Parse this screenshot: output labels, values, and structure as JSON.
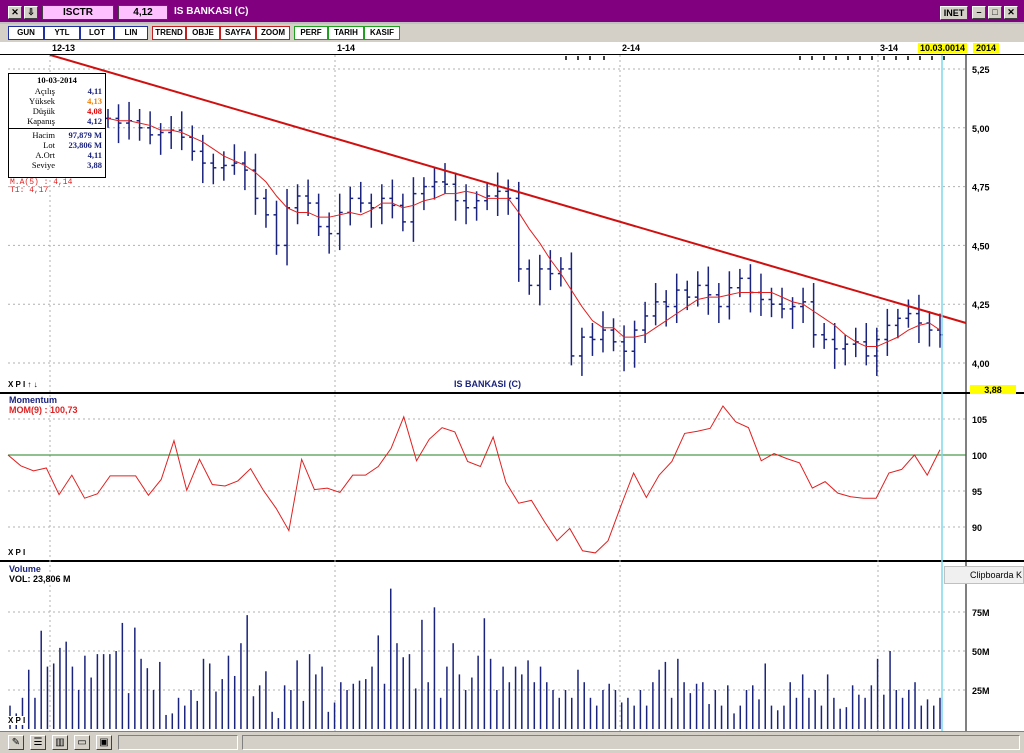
{
  "window": {
    "symbol": "ISCTR",
    "price": "4,12",
    "title": "IS BANKASI (C)",
    "inet_label": "INET"
  },
  "toolbar": {
    "gun": "GUN",
    "ytl": "YTL",
    "lot": "LOT",
    "lin": "LIN",
    "trend": "TREND",
    "obje": "OBJE",
    "sayfa": "SAYFA",
    "zoom": "ZOOM",
    "perf": "PERF",
    "tarih": "TARIH",
    "kasif": "KASIF",
    "e": "E"
  },
  "datebar": {
    "d1": "12-13",
    "d2": "1-14",
    "d3": "2-14",
    "d4": "3-14",
    "current_date": "10.03.0014",
    "year": "2014"
  },
  "info_box": {
    "date": "10-03-2014",
    "acilis_label": "Açılış",
    "acilis": "4,11",
    "yuksek_label": "Yüksek",
    "yuksek": "4,13",
    "dusuk_label": "Düşük",
    "dusuk": "4,08",
    "kapanis_label": "Kapanış",
    "kapanis": "4,12",
    "hacim_label": "Hacim",
    "hacim": "97,879 M",
    "lot_label": "Lot",
    "lot": "23,806 M",
    "aort_label": "A.Ort",
    "aort": "4,11",
    "seviye_label": "Seviye",
    "seviye": "3,88"
  },
  "overlays": {
    "ma": "M.A(5) : 4,14",
    "t1": "T1: 4,17"
  },
  "price_panel": {
    "title": "IS BANKASI (C)",
    "y_ticks": [
      "5,25",
      "5,00",
      "4,75",
      "4,50",
      "4,25",
      "4,00"
    ],
    "level_badge": "3,88",
    "controls": "X P I ↑ ↓"
  },
  "momentum_panel": {
    "title": "Momentum",
    "value_label": "MOM(9) : 100,73",
    "y_ticks": [
      "105",
      "100",
      "95",
      "90"
    ],
    "controls": "X P I"
  },
  "volume_panel": {
    "title": "Volume",
    "value_label": "VOL: 23,806 M",
    "y_ticks": [
      "75M",
      "50M",
      "25M"
    ],
    "controls": "X P I"
  },
  "tooltip": "Clipboarda K",
  "colors": {
    "window": "#800080",
    "bars": "#1a237e",
    "ma": "#e02020",
    "trend": "#d01010",
    "highlight": "#ffff00",
    "cursor": "#7fd8ec"
  },
  "chart_data": [
    {
      "type": "ohlc",
      "title": "IS BANKASI (C)",
      "x": [
        "12-13",
        "1-14",
        "2-14",
        "3-14"
      ],
      "ylim": [
        3.88,
        5.3
      ],
      "last": {
        "date": "10-03-2014",
        "open": 4.11,
        "high": 4.13,
        "low": 4.08,
        "close": 4.12
      },
      "close_series": [
        5.04,
        5.02,
        5.03,
        5.0,
        4.97,
        4.98,
        4.99,
        4.96,
        4.9,
        4.85,
        4.83,
        4.84,
        4.85,
        4.82,
        4.7,
        4.63,
        4.5,
        4.66,
        4.71,
        4.68,
        4.58,
        4.55,
        4.64,
        4.7,
        4.68,
        4.66,
        4.7,
        4.67,
        4.6,
        4.72,
        4.75,
        4.77,
        4.76,
        4.69,
        4.66,
        4.69,
        4.71,
        4.73,
        4.7,
        4.4,
        4.33,
        4.4,
        4.38,
        4.4,
        4.03,
        4.11,
        4.1,
        4.14,
        4.09,
        4.05,
        4.14,
        4.2,
        4.26,
        4.24,
        4.31,
        4.28,
        4.33,
        4.29,
        4.24,
        4.32,
        4.36,
        4.3,
        4.27,
        4.25,
        4.23,
        4.24,
        4.26,
        4.12,
        4.1,
        4.06,
        4.08,
        4.09,
        4.03,
        4.1,
        4.16,
        4.19,
        4.21,
        4.17,
        4.14,
        4.12
      ],
      "series": [
        {
          "name": "M.A(5)",
          "values": [
            5.04,
            5.03,
            5.03,
            5.02,
            5.01,
            4.99,
            4.99,
            4.98,
            4.96,
            4.94,
            4.91,
            4.88,
            4.86,
            4.84,
            4.81,
            4.77,
            4.71,
            4.66,
            4.64,
            4.64,
            4.62,
            4.62,
            4.63,
            4.64,
            4.63,
            4.65,
            4.68,
            4.68,
            4.66,
            4.67,
            4.69,
            4.7,
            4.72,
            4.72,
            4.73,
            4.72,
            4.7,
            4.7,
            4.7,
            4.64,
            4.57,
            4.51,
            4.44,
            4.38,
            4.31,
            4.24,
            4.18,
            4.15,
            4.15,
            4.11,
            4.11,
            4.12,
            4.15,
            4.18,
            4.21,
            4.24,
            4.27,
            4.28,
            4.28,
            4.29,
            4.3,
            4.3,
            4.3,
            4.3,
            4.28,
            4.26,
            4.25,
            4.22,
            4.19,
            4.16,
            4.12,
            4.09,
            4.07,
            4.07,
            4.09,
            4.11,
            4.14,
            4.16,
            4.17,
            4.14
          ]
        },
        {
          "name": "T1",
          "values": [
            5.31,
            4.17
          ]
        }
      ]
    },
    {
      "type": "line",
      "title": "Momentum",
      "ylim": [
        85,
        108
      ],
      "series": [
        {
          "name": "MOM(9)",
          "values": [
            100.0,
            98.5,
            97.8,
            98.2,
            94.5,
            97.2,
            94.0,
            94.6,
            97.1,
            97.1,
            97.1,
            94.4,
            96.6,
            102.0,
            95.1,
            99.4,
            95.9,
            95.7,
            96.4,
            98.1,
            95.1,
            92.6,
            89.5,
            99.4,
            95.2,
            95.4,
            94.8,
            97.2,
            97.2,
            98.4,
            100.9,
            105.3,
            99.2,
            102.2,
            103.8,
            103.2,
            99.1,
            98.4,
            102.5,
            96.2,
            93.3,
            93.7,
            90.8,
            88.1,
            89.8,
            86.7,
            86.4,
            88.1,
            92.9,
            97.5,
            94.1,
            97.2,
            99.1,
            103.0,
            103.3,
            103.7,
            106.8,
            104.6,
            103.8,
            99.2,
            100.2,
            99.5,
            98.9,
            95.4,
            96.3,
            94.7,
            94.2,
            94.0,
            94.0,
            97.5,
            98.0,
            100.0,
            97.2,
            100.73
          ]
        },
        {
          "name": "Reference",
          "values": [
            100,
            100
          ]
        }
      ]
    },
    {
      "type": "bar",
      "title": "Volume",
      "ylim": [
        0,
        90
      ],
      "ylabel": "M",
      "values": [
        15,
        10,
        20,
        38,
        20,
        63,
        40,
        42,
        52,
        56,
        40,
        25,
        47,
        33,
        48,
        48,
        48,
        50,
        68,
        23,
        65,
        45,
        39,
        25,
        43,
        9,
        10,
        20,
        15,
        25,
        18,
        45,
        42,
        24,
        32,
        47,
        34,
        55,
        73,
        21,
        28,
        37,
        11,
        7,
        28,
        25,
        44,
        18,
        48,
        35,
        40,
        11,
        17,
        30,
        25,
        29,
        31,
        32,
        40,
        60,
        29,
        90,
        55,
        46,
        48,
        26,
        70,
        30,
        78,
        20,
        40,
        55,
        35,
        25,
        33,
        47,
        71,
        45,
        25,
        40,
        30,
        40,
        35,
        44,
        30,
        40,
        30,
        25,
        20,
        25,
        20,
        38,
        30,
        20,
        15,
        25,
        29,
        25,
        17,
        20,
        15,
        25,
        15,
        30,
        38,
        43,
        20,
        45,
        30,
        23,
        29,
        30,
        16,
        25,
        15,
        28,
        10,
        15,
        25,
        28,
        19,
        42,
        15,
        12,
        15,
        30,
        20,
        35,
        20,
        25,
        15,
        35,
        20,
        13,
        14,
        28,
        22,
        20,
        28,
        45,
        22,
        50,
        25,
        20,
        25,
        30,
        15,
        19,
        15,
        20
      ]
    }
  ]
}
